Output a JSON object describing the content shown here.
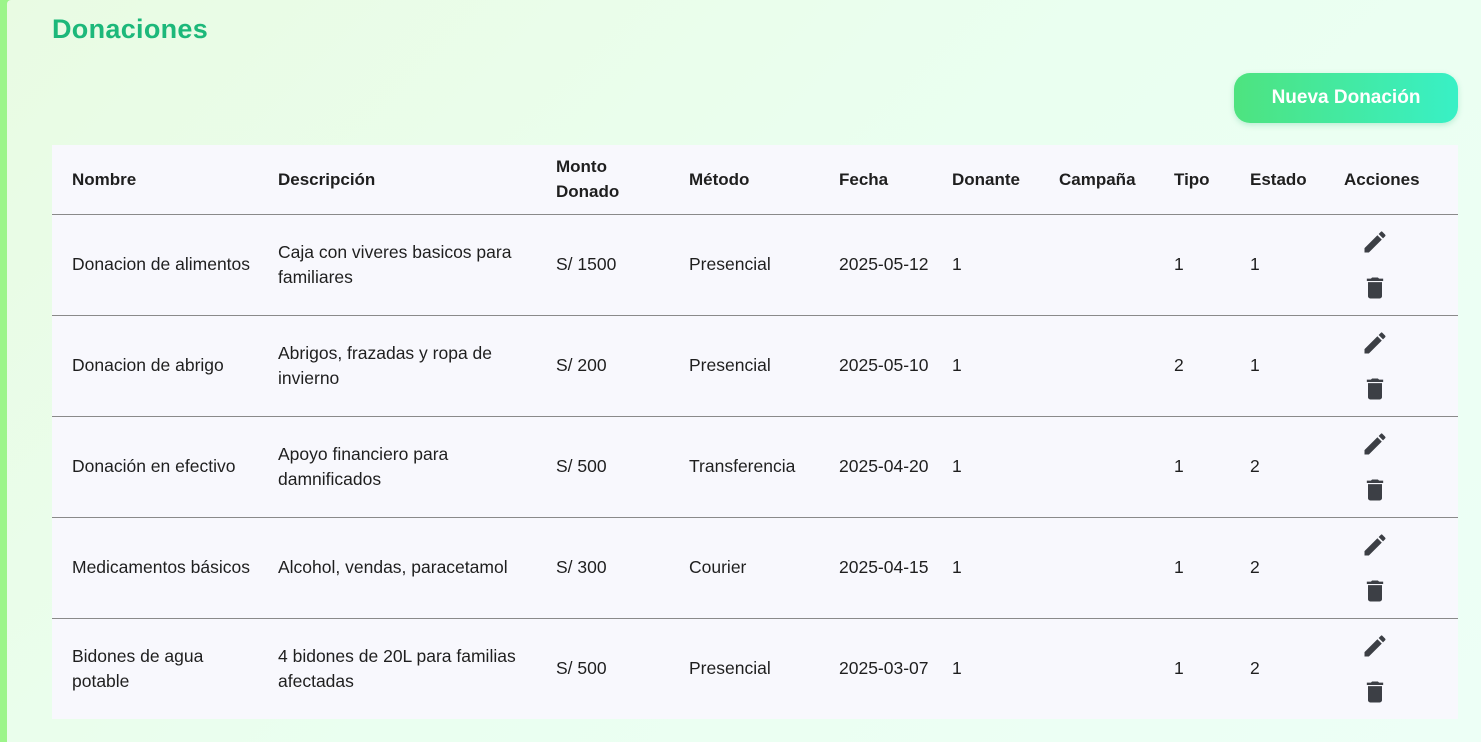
{
  "page": {
    "title": "Donaciones"
  },
  "toolbar": {
    "new_label": "Nueva Donación"
  },
  "table": {
    "headers": [
      "Nombre",
      "Descripción",
      "Monto Donado",
      "Método",
      "Fecha",
      "Donante",
      "Campaña",
      "Tipo",
      "Estado",
      "Acciones"
    ],
    "rows": [
      {
        "nombre": "Donacion de alimentos",
        "descripcion": "Caja con viveres basicos para familiares",
        "monto": "S/ 1500",
        "metodo": "Presencial",
        "fecha": "2025-05-12",
        "donante": "1",
        "campana": "",
        "tipo": "1",
        "estado": "1"
      },
      {
        "nombre": "Donacion de abrigo",
        "descripcion": "Abrigos, frazadas y ropa de invierno",
        "monto": "S/ 200",
        "metodo": "Presencial",
        "fecha": "2025-05-10",
        "donante": "1",
        "campana": "",
        "tipo": "2",
        "estado": "1"
      },
      {
        "nombre": "Donación en efectivo",
        "descripcion": "Apoyo financiero para damnificados",
        "monto": "S/ 500",
        "metodo": "Transferencia",
        "fecha": "2025-04-20",
        "donante": "1",
        "campana": "",
        "tipo": "1",
        "estado": "2"
      },
      {
        "nombre": "Medicamentos básicos",
        "descripcion": "Alcohol, vendas, paracetamol",
        "monto": "S/ 300",
        "metodo": "Courier",
        "fecha": "2025-04-15",
        "donante": "1",
        "campana": "",
        "tipo": "1",
        "estado": "2"
      },
      {
        "nombre": "Bidones de agua potable",
        "descripcion": "4 bidones de 20L para familias afectadas",
        "monto": "S/ 500",
        "metodo": "Presencial",
        "fecha": "2025-03-07",
        "donante": "1",
        "campana": "",
        "tipo": "1",
        "estado": "2"
      }
    ],
    "row_actions": [
      "edit-icon",
      "delete-icon"
    ]
  },
  "colors": {
    "title": "#1cb87a",
    "button_start": "#4ee37f",
    "button_end": "#38f0c6",
    "icon": "#3c3f45"
  }
}
